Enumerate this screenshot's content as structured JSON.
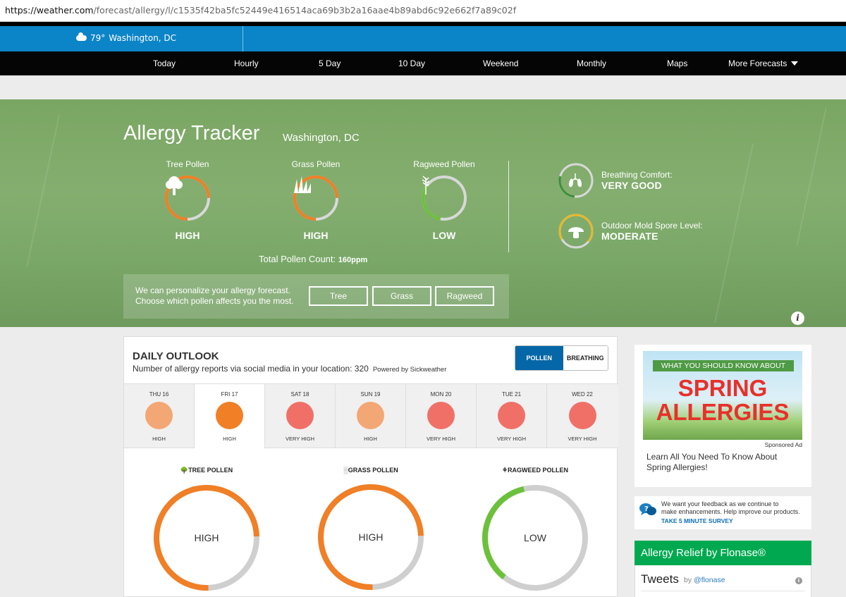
{
  "browser": {
    "url_host": "https://weather.com",
    "url_path": "/forecast/allergy/l/c1535f42ba5fc52449e416514aca69b3b2a16aae4b89abd6c92e662f7a89c02f"
  },
  "header": {
    "temperature": "79°",
    "location": "Washington, DC"
  },
  "nav": {
    "items": [
      "Today",
      "Hourly",
      "5 Day",
      "10 Day",
      "Weekend",
      "Monthly",
      "Maps",
      "More Forecasts"
    ]
  },
  "hero": {
    "title": "Allergy Tracker",
    "location": "Washington, DC",
    "pollen": [
      {
        "label": "Tree Pollen",
        "level": "HIGH",
        "icon": "tree-icon"
      },
      {
        "label": "Grass Pollen",
        "level": "HIGH",
        "icon": "grass-icon"
      },
      {
        "label": "Ragweed Pollen",
        "level": "LOW",
        "icon": "ragweed-icon"
      }
    ],
    "total_label": "Total Pollen Count:",
    "total_value": "160ppm",
    "breathing": {
      "label": "Breathing Comfort:",
      "value": "VERY GOOD"
    },
    "mold": {
      "label": "Outdoor Mold Spore Level:",
      "value": "MODERATE"
    },
    "personalize_line1": "We can personalize your allergy forecast.",
    "personalize_line2": "Choose which pollen affects you the most.",
    "buttons": [
      "Tree",
      "Grass",
      "Ragweed"
    ],
    "info": "i"
  },
  "outlook": {
    "title": "DAILY OUTLOOK",
    "subtitle": "Number of allergy reports via social media in your location: 320",
    "powered": "Powered by Sickweather",
    "toggle": [
      "POLLEN",
      "BREATHING"
    ],
    "days": [
      {
        "name": "THU 16",
        "level": "HIGH",
        "color": "#f3a774"
      },
      {
        "name": "FRI 17",
        "level": "HIGH",
        "color": "#f07f26"
      },
      {
        "name": "SAT 18",
        "level": "VERY HIGH",
        "color": "#f07067"
      },
      {
        "name": "SUN 19",
        "level": "HIGH",
        "color": "#f3a774"
      },
      {
        "name": "MON 20",
        "level": "VERY HIGH",
        "color": "#f07067"
      },
      {
        "name": "TUE 21",
        "level": "VERY HIGH",
        "color": "#f07067"
      },
      {
        "name": "WED 22",
        "level": "VERY HIGH",
        "color": "#f07067"
      }
    ],
    "detail": [
      {
        "label": "TREE POLLEN",
        "level": "HIGH",
        "color": "#f07f26"
      },
      {
        "label": "GRASS POLLEN",
        "level": "HIGH",
        "color": "#f07f26"
      },
      {
        "label": "RAGWEED POLLEN",
        "level": "LOW",
        "color": "#6cc13a"
      }
    ]
  },
  "sidebar": {
    "ad_banner": "WHAT YOU SHOULD KNOW ABOUT",
    "ad_word1": "SPRING",
    "ad_word2": "ALLERGIES",
    "sponsored": "Sponsored Ad",
    "ad_text_line1": "Learn All You Need To Know About",
    "ad_text_line2": "Spring Allergies!",
    "feedback_line1": "We want your feedback as we continue to",
    "feedback_line2": "make enhancements. Help improve our products.",
    "feedback_link": "TAKE 5 MINUTE SURVEY",
    "flonase_title": "Allergy Relief by Flonase®",
    "tweets_title": "Tweets",
    "tweets_by": "by",
    "tweets_handle": "@flonase"
  },
  "colors": {
    "nav_bg": "#050505",
    "top_blue": "#0c84c8",
    "hero_green": "#7fab69",
    "high_orange": "#f07f26",
    "low_green": "#6cc13a",
    "toggle_blue": "#0567a7",
    "flonase_green": "#00a950"
  }
}
